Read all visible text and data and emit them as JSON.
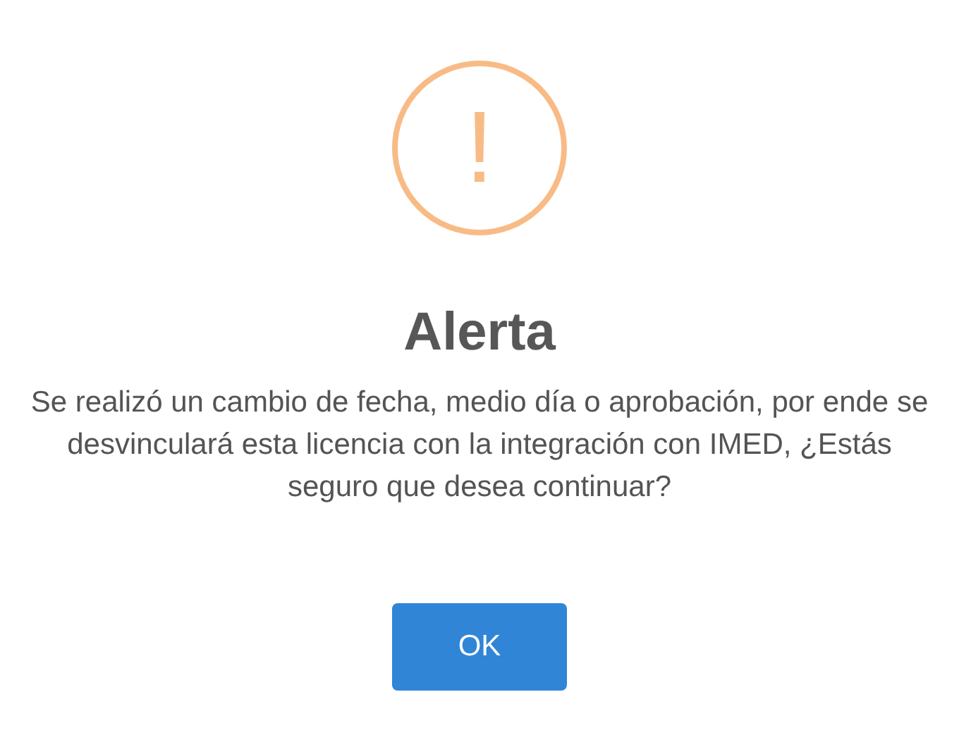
{
  "icon": {
    "kind": "warning",
    "glyph": "!"
  },
  "title": "Alerta",
  "message": "Se realizó un cambio de fecha, medio día o aprobación, por ende se desvinculará esta licencia con la integración con IMED, ¿Estás seguro que desea continuar?",
  "buttons": [
    "OK"
  ]
}
